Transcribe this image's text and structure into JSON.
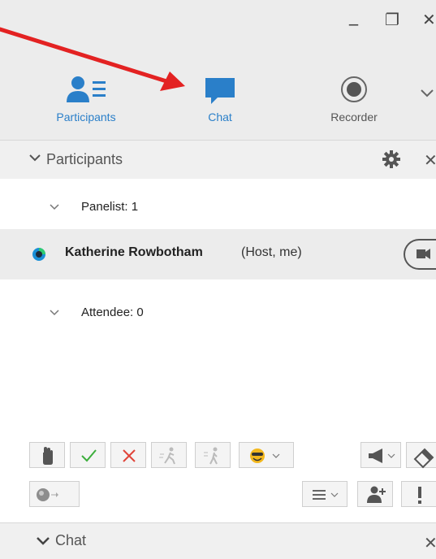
{
  "window": {
    "minimize_glyph": "_",
    "restore_glyph": "❐",
    "close_glyph": "✕"
  },
  "tabs": [
    {
      "label": "Participants",
      "icon": "participants-icon",
      "color": "#2a7fc9"
    },
    {
      "label": "Chat",
      "icon": "chat-bubble-icon",
      "color": "#2a7fc9"
    },
    {
      "label": "Recorder",
      "icon": "record-icon",
      "color": "#555555"
    }
  ],
  "participants_panel": {
    "title": "Participants",
    "close_glyph": "✕",
    "groups": [
      {
        "label": "Panelist: 1"
      },
      {
        "label": "Attendee: 0"
      }
    ],
    "people": [
      {
        "name": "Katherine Rowbotham",
        "role": "(Host, me)",
        "status_color": "#1a8fd6"
      }
    ]
  },
  "toolbar": {
    "icons": [
      "raise-hand-icon",
      "checkmark-icon",
      "x-mark-icon",
      "go-faster-icon",
      "go-slower-icon",
      "emoticon-icon",
      "megaphone-icon",
      "eraser-icon",
      "audio-toggle-icon",
      "list-icon",
      "add-user-icon",
      "alert-icon"
    ]
  },
  "chat_panel": {
    "title": "Chat",
    "close_glyph": "✕"
  },
  "annotation": {
    "arrow_color": "#e32222"
  }
}
